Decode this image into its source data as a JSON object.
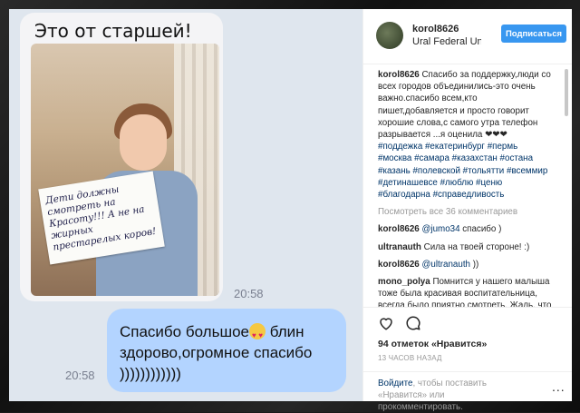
{
  "photo": {
    "incoming_title": "Это от старшей!",
    "sign_text": "Дети должны смотреть на Красоту!!! А не на жирных престарелых коров!",
    "incoming_time": "20:58",
    "outgoing_text_before": "Спасибо большое",
    "outgoing_emoji": "heart-eyes-emoji",
    "outgoing_text_after": " блин здорово,огромное спасибо ))))))))))))",
    "outgoing_time": "20:58"
  },
  "header": {
    "username": "korol8626",
    "location": "Ural Federal Univ...",
    "follow_label": "Подписаться"
  },
  "caption": {
    "username": "korol8626",
    "text": "Спасибо за поддержку,люди со всех городов объединились-это очень важно.спасибо всем,кто пишет,добавляется и просто говорит хорошие слова,с самого утра телефон разрывается ...я оценила ❤❤❤",
    "hashtags": "#поддежка #екатеринбург #пермь #москва #самара #казахстан #остана #казань #полевской #тольятти #всеммир #детинашевсе #люблю #ценю #благодарна #справедливость"
  },
  "view_all": "Посмотреть все 36 комментариев",
  "comments": [
    {
      "user": "korol8626",
      "mention": "@jumo34",
      "text": " спасибо )"
    },
    {
      "user": "ultranauth",
      "mention": "",
      "text": " Сила на твоей стороне! :)"
    },
    {
      "user": "korol8626",
      "mention": "@ultranauth",
      "text": " ))"
    },
    {
      "user": "mono_polya",
      "mention": "",
      "text": " Помнится у нашего малыша тоже была красивая воспитательница, всегда было приятно смотреть. Жаль, что"
    }
  ],
  "stats": {
    "likes_count": "94 отметок",
    "likes_label": " «Нравится»",
    "time_ago": "13 ЧАСОВ НАЗАД"
  },
  "footer": {
    "login_link": "Войдите",
    "login_text": ", чтобы поставить «Нравится» или прокомментировать.",
    "more_label": "..."
  },
  "colors": {
    "accent": "#3897f0",
    "outgoing_bubble": "#b3d4ff",
    "link": "#003569"
  }
}
